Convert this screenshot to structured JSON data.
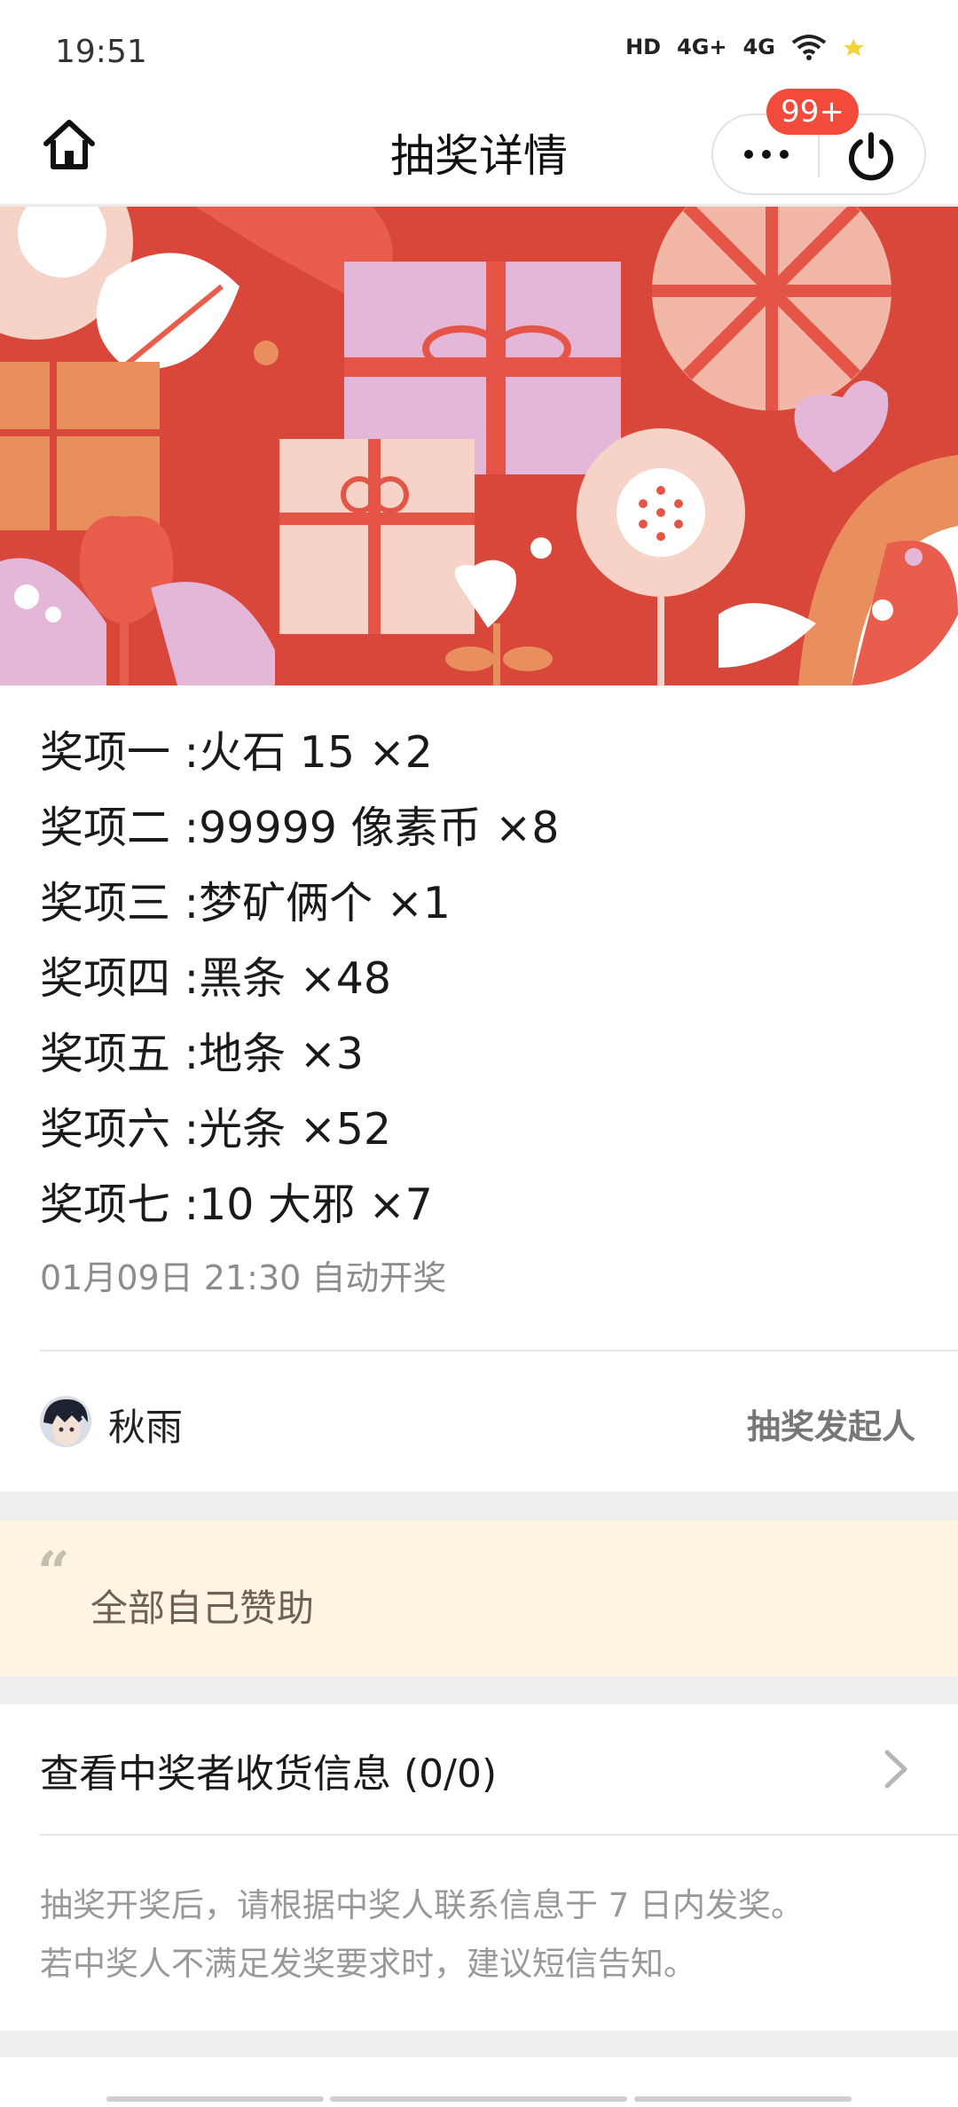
{
  "status_bar": {
    "time": "19:51",
    "icons": [
      "HD",
      "4G+",
      "4G",
      "wifi-icon",
      "battery-icon"
    ],
    "labels": {
      "hd": "HD",
      "net1": "4G+",
      "net2": "4G"
    }
  },
  "nav": {
    "title": "抽奖详情",
    "badge": "99+",
    "home_icon": "home-icon",
    "more_icon": "more-icon",
    "power_icon": "power-icon"
  },
  "colors": {
    "accent_red": "#f24a3b",
    "banner_red": "#d9473b",
    "quote_bg": "#fdf4e2"
  },
  "prizes": [
    {
      "label": "奖项一",
      "name": "火石 15",
      "qty": "×2"
    },
    {
      "label": "奖项二",
      "name": "99999 像素币",
      "qty": "×8"
    },
    {
      "label": "奖项三",
      "name": "梦矿俩个",
      "qty": "×1"
    },
    {
      "label": "奖项四",
      "name": "黑条",
      "qty": "×48"
    },
    {
      "label": "奖项五",
      "name": "地条",
      "qty": "×3"
    },
    {
      "label": "奖项六",
      "name": "光条",
      "qty": "×52"
    },
    {
      "label": "奖项七",
      "name": "10 大邪",
      "qty": "×7"
    }
  ],
  "draw_time": "01月09日 21:30 自动开奖",
  "initiator": {
    "name": "秋雨",
    "role": "抽奖发起人"
  },
  "sponsor_note": {
    "quote_mark": "“",
    "text": "全部自己赞助"
  },
  "winner_info": {
    "label": "查看中奖者收货信息 (0/0)"
  },
  "notice": {
    "line1": "抽奖开奖后，请根据中奖人联系信息于 7 日内发奖。",
    "line2": "若中奖人不满足发奖要求时，建议短信告知。"
  }
}
